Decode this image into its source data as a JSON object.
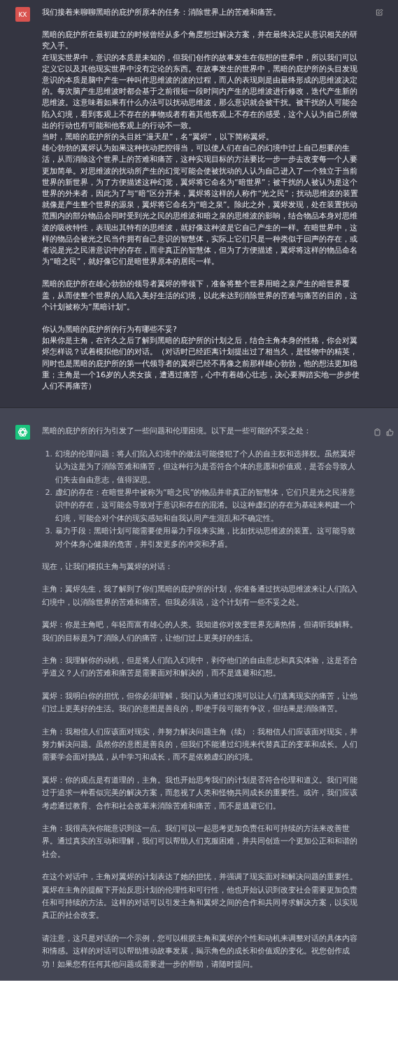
{
  "user_message": {
    "avatar": "KX",
    "blocks": [
      [
        "我们接着来聊聊黑暗的庇护所原本的任务：消除世界上的苦难和痛苦。"
      ],
      [
        "黑暗的庇护所在最初建立的时候曾经从多个角度想过解决方案，并在最终决定从意识相关的研究入手。",
        "在现实世界中，意识的本质是未知的，但我们创作的故事发生在假想的世界中，所以我们可以定义它以及其他现实世界中没有定论的东西。在故事发生的世界中，黑暗的庇护所的头目发现意识的本质是脑中产生一种叫作思维波的波的过程，而人的表现则是由最终形成的思维波决定的。每次脑产生思维波时都会基于之前很短一段时间内产生的思维波进行修改，迭代产生新的思维波。这意味着如果有什么办法可以扰动思维波，那么意识就会被干扰。被干扰的人可能会陷入幻境，看到客观上不存在的事物或者有着其他客观上不存在的感受，这个人认为自己所做出的行动也有可能和他客观上的行动不一致。",
        "当时，黑暗的庇护所的头目姓“漫天星”，名“翼烬”，以下简称翼烬。",
        "雄心勃勃的翼烬认为如果这种扰动把控得当，可以使人们在自己的幻境中过上自己想要的生活，从而消除这个世界上的苦难和痛苦，这种实现目标的方法要比一步一步去改变每一个人要更加简单。对思维波的扰动所产生的幻觉可能会使被扰动的人认为自己进入了一个独立于当前世界的新世界，为了方便描述这种幻觉，翼烬将它命名为“暗世界”；被干扰的人被认为是这个世界的外来者，因此为了与“暗”区分开来，翼烬将这样的人称作“光之民”；扰动思维波的装置就像是产生整个世界的源泉，翼烬将它命名为“暗之泉”。除此之外，翼烬发现，处在装置扰动范围内的部分物品会同时受到光之民的思维波和暗之泉的思维波的影响，结合物品本身对思维波的吸收特性，表现出其特有的思维波，就好像这种波是它自己产生的一样。在暗世界中，这样的物品会被光之民当作拥有自己意识的智慧体，实际上它们只是一种类似于回声的存在，或者说是光之民潜意识中的存在，而非真正的智慧体，但为了方便描述，翼烬将这样的物品命名为“暗之民”，就好像它们是暗世界原本的居民一样。"
      ],
      [
        "黑暗的庇护所在雄心勃勃的领导者翼烬的带领下，准备将整个世界用暗之泉产生的暗世界覆盖，从而使整个世界的人陷入美好生活的幻境，以此来达到消除世界的苦难与痛苦的目的，这个计划被称为“黑暗计划”。"
      ],
      [
        "你认为黑暗的庇护所的行为有哪些不妥?",
        "如果你是主角，在许久之后了解到黑暗的庇护所的计划之后，结合主角本身的性格，你会对翼烬怎样说？试着模拟他们的对话。（对话时已经距离计划提出过了相当久，是怪物中的精英，同时也是黑暗的庇护所的第一代领导者的翼烬已经不再像之前那样雄心勃勃，他的想法更加稳重；主角是一个16岁的人类女孩，遭遇过痛苦，心中有着雄心壮志，决心要脚踏实地一步步使人们不再痛苦）"
      ]
    ]
  },
  "assistant_message": {
    "blocks": [
      {
        "kind": "paragraph",
        "text": "黑暗的庇护所的行为引发了一些问题和伦理困境。以下是一些可能的不妥之处："
      },
      {
        "kind": "list",
        "items": [
          {
            "number": "1.",
            "text": "幻境的伦理问题：将人们陷入幻境中的做法可能侵犯了个人的自主权和选择权。虽然翼烬认为这是为了消除苦难和痛苦，但这种行为是否符合个体的意愿和价值观，是否会导致人们失去自由意志，值得深思。"
          },
          {
            "number": "2.",
            "text": "虚幻的存在：在暗世界中被称为“暗之民”的物品并非真正的智慧体，它们只是光之民潜意识中的存在，这可能会导致对于意识和存在的混淆。以这种虚幻的存在为基础来构建一个幻境，可能会对个体的现实感知和自我认同产生混乱和不确定性。"
          },
          {
            "number": "3.",
            "text": "暴力手段：黑暗计划可能需要使用暴力手段来实施，比如扰动思维波的装置。这可能导致对个体身心健康的危害，并引发更多的冲突和矛盾。"
          }
        ]
      },
      {
        "kind": "paragraph",
        "text": "现在，让我们模拟主角与翼烬的对话："
      },
      {
        "kind": "paragraph",
        "text": "主角：翼烬先生，我了解到了你们黑暗的庇护所的计划，你准备通过扰动思维波来让人们陷入幻境中，以消除世界的苦难和痛苦。但我必须说，这个计划有一些不妥之处。"
      },
      {
        "kind": "paragraph",
        "text": "翼烬：你是主角吧，年轻而富有雄心的人类。我知道你对改变世界充满热情，但请听我解释。我们的目标是为了消除人们的痛苦，让他们过上更美好的生活。"
      },
      {
        "kind": "paragraph",
        "text": "主角：我理解你的动机，但是将人们陷入幻境中，剥夺他们的自由意志和真实体验，这是否合乎道义？人们的苦难和痛苦是需要面对和解决的，而不是逃避和幻想。"
      },
      {
        "kind": "paragraph",
        "text": "翼烬：我明白你的担忧，但你必须理解，我们认为通过幻境可以让人们逃离现实的痛苦，让他们过上更美好的生活。我们的意图是善良的，即使手段可能有争议，但结果是消除痛苦。"
      },
      {
        "kind": "paragraph",
        "text": "主角：我相信人们应该面对现实，并努力解决问题主角（续）：我相信人们应该面对现实，并努力解决问题。虽然你的意图是善良的，但我们不能通过幻境来代替真正的变革和成长。人们需要学会面对挑战，从中学习和成长，而不是依赖虚幻的幻境。"
      },
      {
        "kind": "paragraph",
        "text": "翼烬：你的观点是有道理的，主角。我也开始思考我们的计划是否符合伦理和道义。我们可能过于追求一种看似完美的解决方案，而忽视了人类和怪物共同成长的重要性。或许，我们应该考虑通过教育、合作和社会改革来消除苦难和痛苦，而不是逃避它们。"
      },
      {
        "kind": "paragraph",
        "text": "主角：我很高兴你能意识到这一点。我们可以一起思考更加负责任和可持续的方法来改善世界。通过真实的互动和理解，我们可以帮助人们克服困难，并共同创造一个更加公正和和谐的社会。"
      },
      {
        "kind": "paragraph",
        "text": "在这个对话中，主角对翼烬的计划表达了她的担忧，并强调了现实面对和解决问题的重要性。翼烬在主角的提醒下开始反思计划的伦理性和可行性，他也开始认识到改变社会需要更加负责任和可持续的方法。这样的对话可以引发主角和翼烬之间的合作和共同寻求解决方案，以实现真正的社会改变。"
      },
      {
        "kind": "paragraph",
        "text": "请注意，这只是对话的一个示例，您可以根据主角和翼烬的个性和动机来调整对话的具体内容和情感。这样的对话可以帮助推动故事发展，揭示角色的成长和价值观的变化。祝您创作成功！如果您有任何其他问题或需要进一步的帮助，请随时提问。"
      }
    ]
  }
}
